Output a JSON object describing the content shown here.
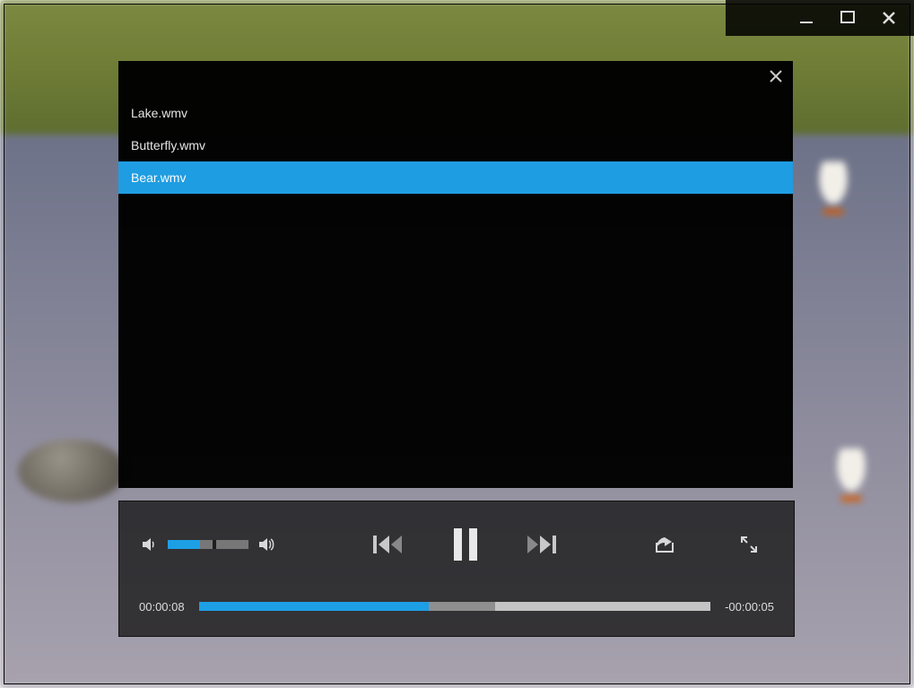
{
  "playlist": {
    "items": [
      {
        "name": "Lake.wmv",
        "selected": false
      },
      {
        "name": "Butterfly.wmv",
        "selected": false
      },
      {
        "name": "Bear.wmv",
        "selected": true
      }
    ]
  },
  "player": {
    "state": "paused",
    "elapsed": "00:00:08",
    "remaining": "-00:00:05",
    "progress_percent": 45,
    "buffered_start_percent": 58,
    "volume_percent": 40
  },
  "colors": {
    "accent": "#1d9fe5",
    "panel_bg": "#000000",
    "control_bg": "rgba(20,20,20,.78)",
    "text": "#eaeaea"
  },
  "icons": {
    "window": [
      "minimize-icon",
      "maximize-icon",
      "close-icon"
    ],
    "playlist": [
      "close-icon"
    ],
    "controls": [
      "speaker-low-icon",
      "speaker-high-icon",
      "skip-previous-icon",
      "pause-icon",
      "skip-next-icon",
      "share-icon",
      "fullscreen-icon"
    ]
  }
}
